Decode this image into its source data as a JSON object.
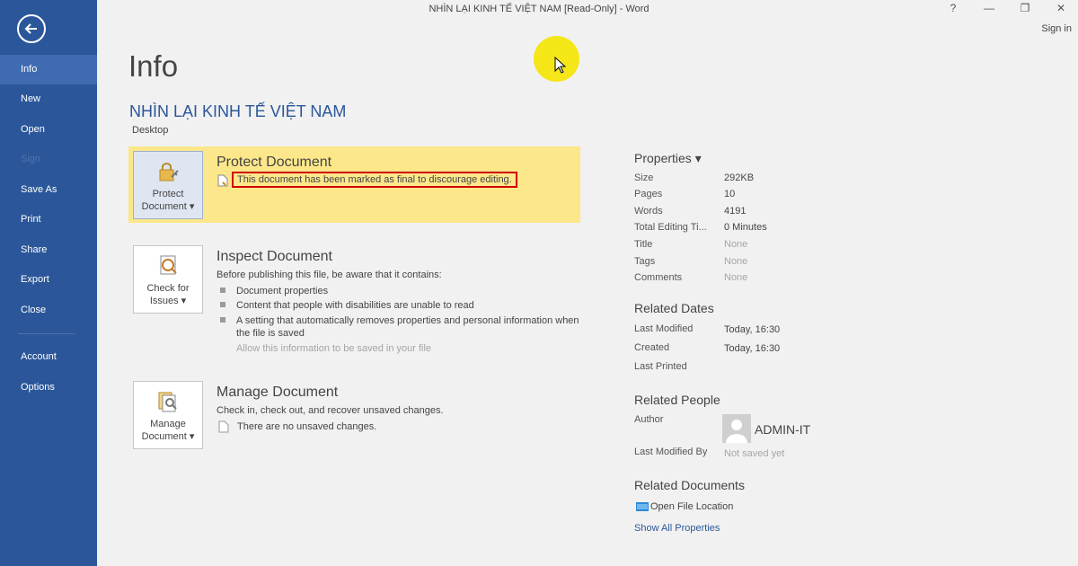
{
  "window": {
    "title": "NHÌN LẠI KINH TẾ VIỆT NAM [Read-Only] - Word",
    "help": "?",
    "minimize": "—",
    "restore": "❐",
    "close": "✕",
    "sign_in": "Sign in"
  },
  "sidebar": {
    "items": [
      {
        "label": "Info"
      },
      {
        "label": "New"
      },
      {
        "label": "Open"
      },
      {
        "label": "Sign"
      },
      {
        "label": "Save As"
      },
      {
        "label": "Print"
      },
      {
        "label": "Share"
      },
      {
        "label": "Export"
      },
      {
        "label": "Close"
      },
      {
        "label": "Account"
      },
      {
        "label": "Options"
      }
    ]
  },
  "main": {
    "heading": "Info",
    "doc_title": "NHÌN LẠI KINH TẾ VIỆT NAM",
    "doc_location": "Desktop",
    "protect": {
      "button_line1": "Protect",
      "button_line2": "Document ▾",
      "title": "Protect Document",
      "status": "This document has been marked as final to discourage editing."
    },
    "inspect": {
      "button_line1": "Check for",
      "button_line2": "Issues ▾",
      "title": "Inspect Document",
      "intro": "Before publishing this file, be aware that it contains:",
      "bullets": [
        "Document properties",
        "Content that people with disabilities are unable to read",
        "A setting that automatically removes properties and personal information when",
        "the file is saved"
      ],
      "allow": "Allow this information to be saved in your file"
    },
    "manage": {
      "button_line1": "Manage",
      "button_line2": "Document ▾",
      "title": "Manage Document",
      "desc": "Check in, check out, and recover unsaved changes.",
      "status": "There are no unsaved changes."
    }
  },
  "properties": {
    "heading": "Properties ▾",
    "rows": [
      {
        "label": "Size",
        "value": "292KB"
      },
      {
        "label": "Pages",
        "value": "10"
      },
      {
        "label": "Words",
        "value": "4191"
      },
      {
        "label": "Total Editing Ti...",
        "value": "0 Minutes"
      },
      {
        "label": "Title",
        "value": "None"
      },
      {
        "label": "Tags",
        "value": "None"
      },
      {
        "label": "Comments",
        "value": "None"
      }
    ],
    "related_dates": {
      "heading": "Related Dates",
      "rows": [
        {
          "label": "Last Modified",
          "value": "Today, 16:30"
        },
        {
          "label": "Created",
          "value": "Today, 16:30"
        },
        {
          "label": "Last Printed",
          "value": ""
        }
      ]
    },
    "related_people": {
      "heading": "Related People",
      "author_label": "Author",
      "author_name": "ADMIN-IT",
      "last_modified_by_label": "Last Modified By",
      "last_modified_by_value": "Not saved yet"
    },
    "related_documents": {
      "heading": "Related Documents",
      "open_location": "Open File Location",
      "show_all": "Show All Properties"
    }
  },
  "colors": {
    "sidebar": "#2b579a",
    "sidebar_active": "#3f6bb0",
    "highlight": "#fce78a",
    "title_blue": "#2b579a",
    "red_box": "#d00000",
    "cursor_highlight": "#f5e400"
  }
}
